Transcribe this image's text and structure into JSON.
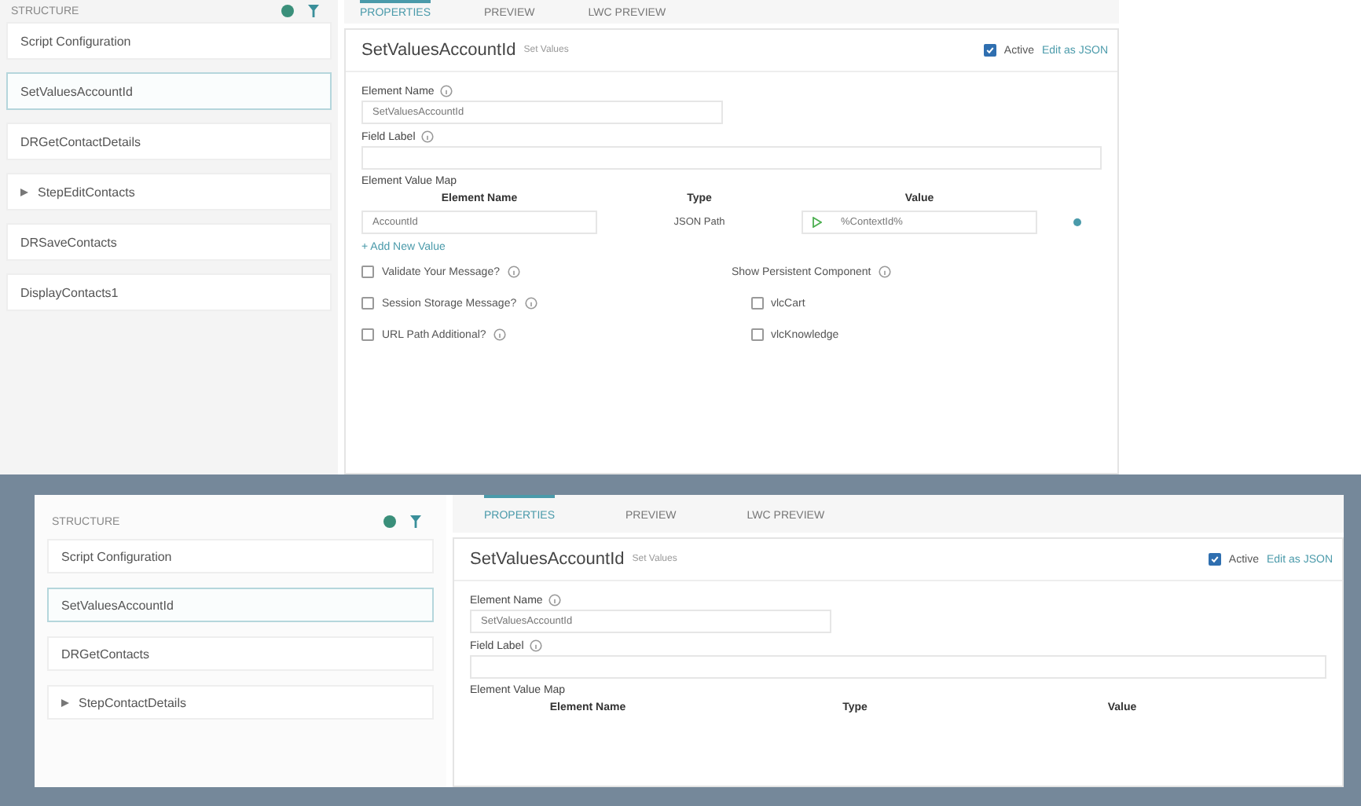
{
  "panels": [
    {
      "framed": false,
      "structure": {
        "title": "STRUCTURE",
        "items": [
          {
            "label": "Script Configuration",
            "expandable": false,
            "selected": false
          },
          {
            "label": "SetValuesAccountId",
            "expandable": false,
            "selected": true
          },
          {
            "label": "DRGetContactDetails",
            "expandable": false,
            "selected": false
          },
          {
            "label": "StepEditContacts",
            "expandable": true,
            "selected": false
          },
          {
            "label": "DRSaveContacts",
            "expandable": false,
            "selected": false
          },
          {
            "label": "DisplayContacts1",
            "expandable": false,
            "selected": false
          }
        ]
      },
      "tabs": [
        {
          "label": "PROPERTIES",
          "selected": true
        },
        {
          "label": "PREVIEW",
          "selected": false
        },
        {
          "label": "LWC PREVIEW",
          "selected": false
        }
      ],
      "element": {
        "name": "SetValuesAccountId",
        "type": "Set Values",
        "active": true,
        "active_label": "Active",
        "edit_link": "Edit as JSON",
        "element_name_label": "Element Name",
        "element_name_value": "SetValuesAccountId",
        "field_label_label": "Field Label",
        "value_map_label": "Element Value Map",
        "columns": [
          "Element Name",
          "Type",
          "Value"
        ],
        "rows": [
          {
            "element_name": "AccountId",
            "type": "JSON Path",
            "value": "%ContextId%"
          }
        ],
        "add_label": "+ Add New Value",
        "options": [
          {
            "label": "Validate Your Message?",
            "checked": false
          },
          {
            "label": "Session Storage Message?",
            "checked": false
          },
          {
            "label": "URL Path Additional?",
            "checked": false
          }
        ],
        "persistent": {
          "label": "Show Persistent Component",
          "options": [
            {
              "label": "vlcCart",
              "checked": false
            },
            {
              "label": "vlcKnowledge",
              "checked": false
            }
          ]
        }
      }
    },
    {
      "framed": true,
      "structure": {
        "title": "STRUCTURE",
        "items": [
          {
            "label": "Script Configuration",
            "expandable": false,
            "selected": false
          },
          {
            "label": "SetValuesAccountId",
            "expandable": false,
            "selected": true
          },
          {
            "label": "DRGetContacts",
            "expandable": false,
            "selected": false
          },
          {
            "label": "StepContactDetails",
            "expandable": true,
            "selected": false
          }
        ]
      },
      "tabs": [
        {
          "label": "PROPERTIES",
          "selected": true
        },
        {
          "label": "PREVIEW",
          "selected": false
        },
        {
          "label": "LWC PREVIEW",
          "selected": false
        }
      ],
      "element": {
        "name": "SetValuesAccountId",
        "type": "Set Values",
        "active": true,
        "active_label": "Active",
        "edit_link": "Edit as JSON",
        "element_name_label": "Element Name",
        "element_name_value": "SetValuesAccountId",
        "field_label_label": "Field Label",
        "value_map_label": "Element Value Map",
        "columns": [
          "Element Name",
          "Type",
          "Value"
        ]
      }
    }
  ]
}
